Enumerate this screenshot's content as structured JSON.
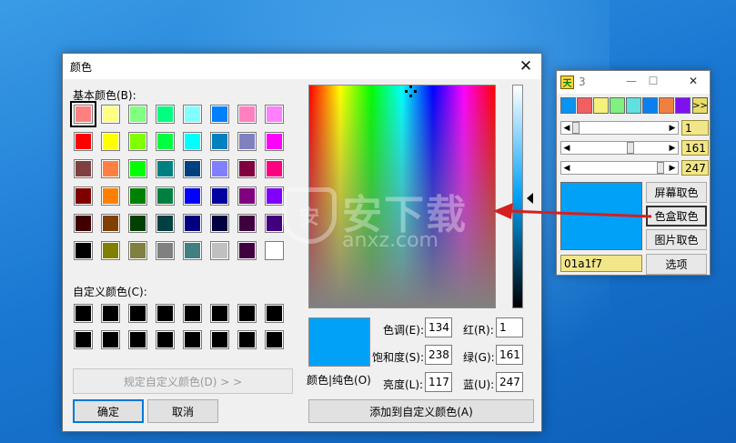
{
  "dialog": {
    "title": "颜色",
    "basic_label": "基本颜色(B):",
    "custom_label": "自定义颜色(C):",
    "define_custom_label": "规定自定义颜色(D) > >",
    "ok_label": "确定",
    "cancel_label": "取消",
    "add_custom_label": "添加到自定义颜色(A)",
    "color_solid_label": "颜色|纯色(O)",
    "fields": {
      "hue": {
        "label": "色调(E):",
        "value": "134"
      },
      "sat": {
        "label": "饱和度(S):",
        "value": "238"
      },
      "lum": {
        "label": "亮度(L):",
        "value": "117"
      },
      "red": {
        "label": "红(R):",
        "value": "1"
      },
      "green": {
        "label": "绿(G):",
        "value": "161"
      },
      "blue": {
        "label": "蓝(U):",
        "value": "247"
      }
    },
    "basic_colors": [
      "#ff8080",
      "#ffff80",
      "#80ff80",
      "#00ff80",
      "#80ffff",
      "#0080ff",
      "#ff80c0",
      "#ff80ff",
      "#ff0000",
      "#ffff00",
      "#80ff00",
      "#00ff40",
      "#00ffff",
      "#0080c0",
      "#8080c0",
      "#ff00ff",
      "#804040",
      "#ff8040",
      "#00ff00",
      "#008080",
      "#004080",
      "#8080ff",
      "#800040",
      "#ff0080",
      "#800000",
      "#ff8000",
      "#008000",
      "#008040",
      "#0000ff",
      "#0000a0",
      "#800080",
      "#8000ff",
      "#400000",
      "#804000",
      "#004000",
      "#004040",
      "#000080",
      "#000040",
      "#400040",
      "#400080",
      "#000000",
      "#808000",
      "#808040",
      "#808080",
      "#408080",
      "#c0c0c0",
      "#400040",
      "#ffffff"
    ],
    "selected_index": 0,
    "current_color": "#00a1f7"
  },
  "tool": {
    "title": "3",
    "min_glyph": "—",
    "max_glyph": "☐",
    "close_glyph": "✕",
    "more_label": ">>",
    "swatches": [
      "#0a93f2",
      "#f06060",
      "#f7f07a",
      "#80f080",
      "#60e0e0",
      "#0a80f0",
      "#f08040",
      "#8010f0"
    ],
    "sliders": [
      {
        "value": "1",
        "fraction": 0.0
      },
      {
        "value": "161",
        "fraction": 0.63
      },
      {
        "value": "247",
        "fraction": 0.97
      }
    ],
    "hex_value": "01a1f7",
    "buttons": {
      "screen": "屏幕取色",
      "box": "色盒取色",
      "image": "图片取色",
      "options": "选项"
    }
  },
  "watermark": {
    "cn": "安下载",
    "en": "anxz.com",
    "shield_glyph": "安"
  }
}
